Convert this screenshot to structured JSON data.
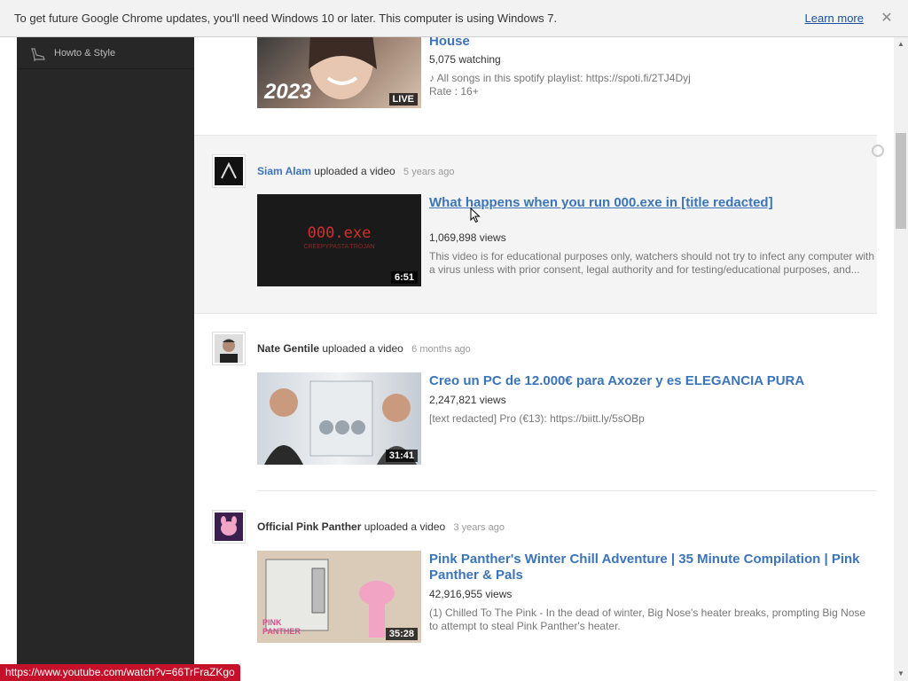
{
  "infobar": {
    "message": "To get future Google Chrome updates, you'll need Windows 10 or later. This computer is using Windows 7.",
    "learn_more": "Learn more",
    "close_icon": "close-icon"
  },
  "sidebar": {
    "items": [
      {
        "label": "Howto & Style",
        "icon": "high-heel-icon"
      }
    ]
  },
  "feed": {
    "entries": [
      {
        "title": "House",
        "meta": "5,075 watching",
        "desc_line1": "♪ All songs in this spotify playlist: https://spoti.fi/2TJ4Dyj",
        "desc_line2": "Rate : 16+",
        "badge": "LIVE",
        "thumb_text": "2023"
      },
      {
        "channel": "Siam Alam",
        "action": "uploaded a video",
        "ago": "5 years ago",
        "title": "What happens when you run 000.exe in [title redacted]",
        "meta": "1,069,898 views",
        "desc": "This video is for educational purposes only, watchers should not try to infect any computer with a virus unless with prior consent, legal authority and for testing/educational purposes, and...",
        "duration": "6:51",
        "thumb_text": "000.exe",
        "thumb_sub": "CREEPYPASTA TROJAN"
      },
      {
        "channel": "Nate Gentile",
        "action": "uploaded a video",
        "ago": "6 months ago",
        "title": "Creo un PC de 12.000€ para Axozer y es ELEGANCIA PURA",
        "meta": "2,247,821 views",
        "desc": "[text redacted] Pro (€13): https://biitt.ly/5sOBp",
        "duration": "31:41"
      },
      {
        "channel": "Official Pink Panther",
        "action": "uploaded a video",
        "ago": "3 years ago",
        "title": "Pink Panther's Winter Chill Adventure | 35 Minute Compilation | Pink Panther & Pals",
        "meta": "42,916,955 views",
        "desc": "(1) Chilled To The Pink - In the dead of winter, Big Nose's heater breaks, prompting Big Nose to attempt to steal Pink Panther's heater.",
        "duration": "35:28",
        "thumb_text": "PINK PANTHER"
      }
    ]
  },
  "status_url": "https://www.youtube.com/watch?v=66TrFraZKgo",
  "colors": {
    "link_blue": "#3b74b8",
    "sidebar_bg": "#272727",
    "status_red": "#c5102a"
  }
}
